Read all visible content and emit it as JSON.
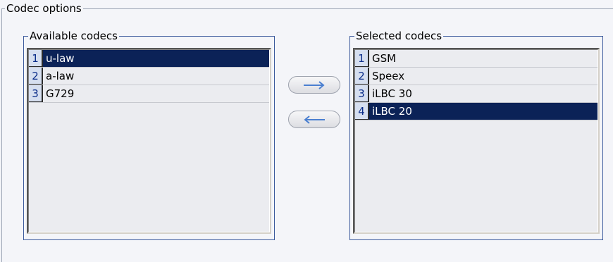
{
  "codec_options": {
    "title": "Codec options"
  },
  "available": {
    "title": "Available codecs",
    "items": [
      {
        "num": "1",
        "label": "u-law",
        "selected": true
      },
      {
        "num": "2",
        "label": "a-law",
        "selected": false
      },
      {
        "num": "3",
        "label": "G729",
        "selected": false
      }
    ]
  },
  "selected": {
    "title": "Selected codecs",
    "items": [
      {
        "num": "1",
        "label": "GSM",
        "selected": false
      },
      {
        "num": "2",
        "label": "Speex",
        "selected": false
      },
      {
        "num": "3",
        "label": "iLBC 30",
        "selected": false
      },
      {
        "num": "4",
        "label": "iLBC 20",
        "selected": true
      }
    ]
  },
  "buttons": {
    "add_icon": "arrow-right-icon",
    "remove_icon": "arrow-left-icon",
    "arrow_color": "#4a7fd0"
  },
  "colors": {
    "selection_bg": "#0b2257",
    "group_border": "#3c5a9c"
  }
}
